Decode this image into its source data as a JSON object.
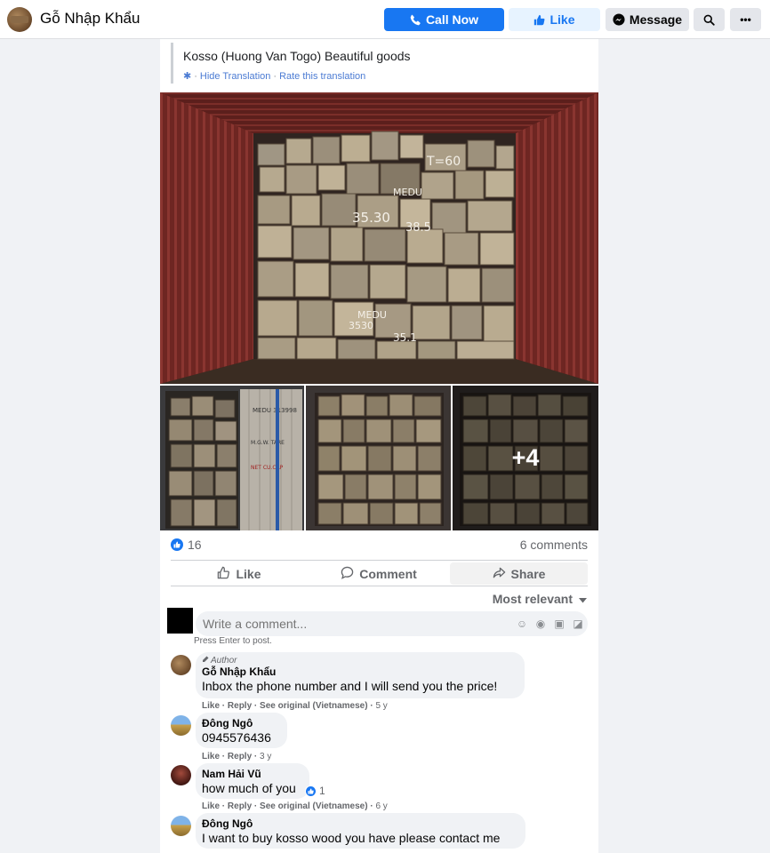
{
  "header": {
    "page_name": "Gỗ Nhập Khẩu",
    "call_label": "Call Now",
    "like_label": "Like",
    "message_label": "Message",
    "more_label": "•••"
  },
  "post": {
    "text": "Kosso (Huong Van Togo) Beautiful goods",
    "hide_translation": "Hide Translation",
    "link_separator": "·",
    "rate_translation": "Rate this translation",
    "more_photos_label": "+4",
    "chalk_marks": [
      "T=60",
      "MEDU",
      "35.30",
      "38.5",
      "MEDU",
      "3530",
      "35.1"
    ],
    "thumb_container_marks": [
      "MEDU 313998",
      "M.G.W. TARE",
      "NET CU.CAP"
    ]
  },
  "stats": {
    "reactions": "16",
    "comments": "6 comments"
  },
  "actions": {
    "like": "Like",
    "comment": "Comment",
    "share": "Share"
  },
  "sort": {
    "label": "Most relevant"
  },
  "composer": {
    "placeholder": "Write a comment...",
    "hint": "Press Enter to post."
  },
  "comments": [
    {
      "author_tag": "Author",
      "name": "Gỗ Nhập Khẩu",
      "text": "Inbox the phone number and I will send you the price!",
      "like": "Like",
      "reply": "Reply",
      "see_original": "See original (Vietnamese)",
      "age": "5 y"
    },
    {
      "name": "Đông Ngô",
      "text": "0945576436",
      "like": "Like",
      "reply": "Reply",
      "age": "3 y"
    },
    {
      "name": "Nam Hải Vũ",
      "text": "how much of you",
      "reactions": "1",
      "like": "Like",
      "reply": "Reply",
      "see_original": "See original (Vietnamese)",
      "age": "6 y"
    },
    {
      "name": "Đông Ngô",
      "text": "I want to buy kosso wood you have please contact me"
    }
  ],
  "colors": {
    "accent": "#1877f2",
    "accent_light": "#e7f3ff",
    "link": "#4b7bd3",
    "muted": "#65676b",
    "bubble": "#f0f2f5",
    "container_red": "#7a2a26",
    "wood": "#a89a82"
  }
}
